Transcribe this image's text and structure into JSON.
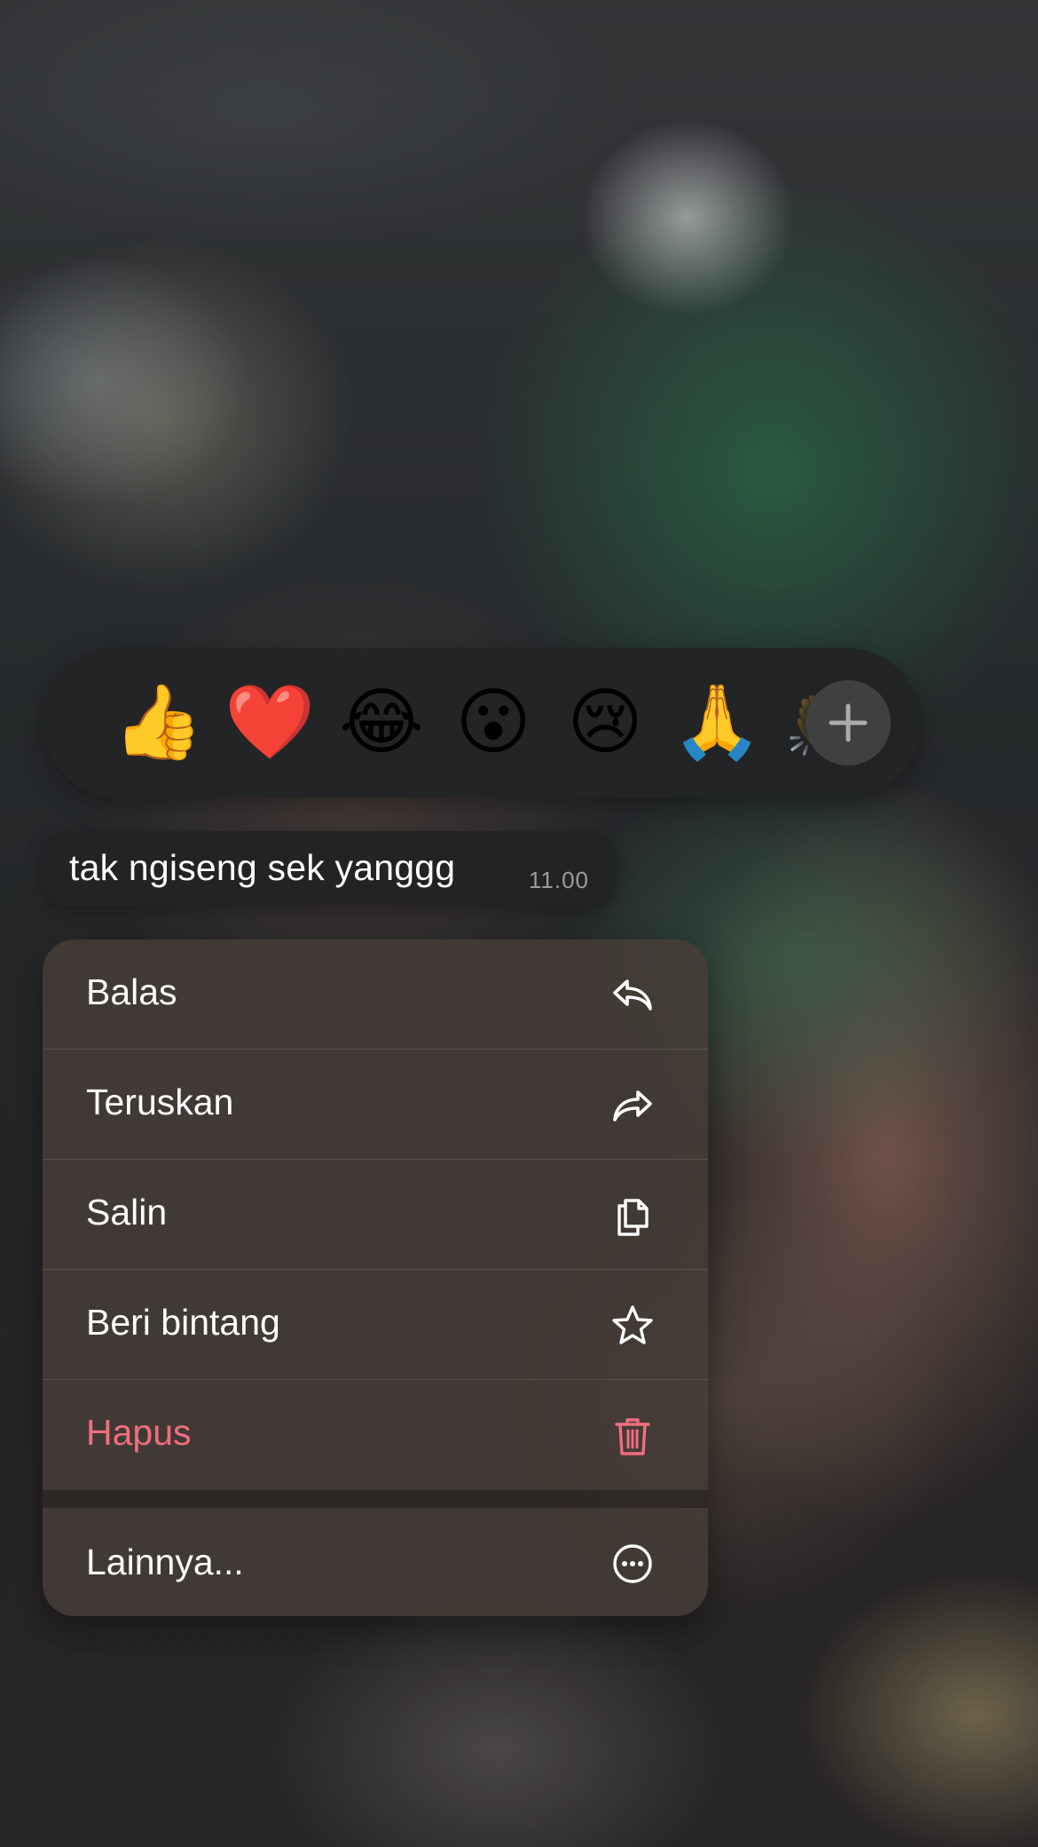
{
  "reactions": [
    {
      "emoji": "👍",
      "name": "thumbs-up"
    },
    {
      "emoji": "❤️",
      "name": "red-heart"
    },
    {
      "emoji": "😂",
      "name": "tears-of-joy"
    },
    {
      "emoji": "😮",
      "name": "open-mouth"
    },
    {
      "emoji": "😢",
      "name": "crying-face"
    },
    {
      "emoji": "🙏",
      "name": "folded-hands"
    },
    {
      "emoji": "👏",
      "name": "clapping-hands"
    }
  ],
  "message": {
    "text": "tak ngiseng sek yanggg",
    "time": "11.00"
  },
  "menu": {
    "reply": {
      "label": "Balas",
      "icon": "reply-icon"
    },
    "forward": {
      "label": "Teruskan",
      "icon": "forward-icon"
    },
    "copy": {
      "label": "Salin",
      "icon": "copy-icon"
    },
    "star": {
      "label": "Beri bintang",
      "icon": "star-icon"
    },
    "delete": {
      "label": "Hapus",
      "icon": "trash-icon"
    },
    "more": {
      "label": "Lainnya...",
      "icon": "more-icon"
    }
  },
  "colors": {
    "danger": "#f06e7e",
    "menu_bg": "#463c38",
    "bubble_bg": "#222324",
    "reaction_bar_bg": "#232425"
  }
}
